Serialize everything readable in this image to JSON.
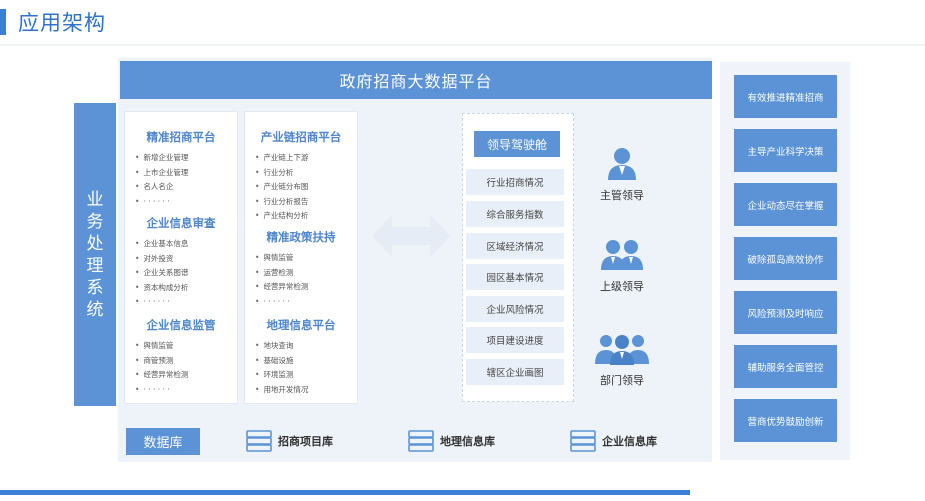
{
  "header": {
    "title": "应用架构"
  },
  "platform": {
    "title": "政府招商大数据平台"
  },
  "side_column": {
    "chars": [
      "业",
      "务",
      "处",
      "理",
      "系",
      "统"
    ]
  },
  "left_panel": {
    "sections": [
      {
        "title": "精准招商平台",
        "items": [
          "新增企业管理",
          "上市企业管理",
          "名人名企",
          "· · · · · ·"
        ]
      },
      {
        "title": "企业信息审查",
        "items": [
          "企业基本信息",
          "对外投资",
          "企业关系图谱",
          "资本构成分析",
          "· · · · · ·"
        ]
      },
      {
        "title": "企业信息监管",
        "items": [
          "舆情监管",
          "商管预测",
          "经营异常检测",
          "· · · · · ·"
        ]
      }
    ]
  },
  "middle_panel": {
    "sections": [
      {
        "title": "产业链招商平台",
        "items": [
          "产业链上下游",
          "行业分析",
          "产业链分布图",
          "行业分析报告",
          "产业结构分析"
        ]
      },
      {
        "title": "精准政策扶持",
        "items": [
          "舆情监管",
          "运营检测",
          "经营异常检测",
          "· · · · · ·"
        ]
      },
      {
        "title": "地理信息平台",
        "items": [
          "地块查询",
          "基础设施",
          "环境监测",
          "用地开发情况"
        ]
      }
    ]
  },
  "cockpit": {
    "title": "领导驾驶舱",
    "items": [
      "行业招商情况",
      "综合服务指数",
      "区域经济情况",
      "园区基本情况",
      "企业风险情况",
      "项目建设进度",
      "辖区企业画图"
    ]
  },
  "roles": [
    {
      "label": "主管领导",
      "icon": "single-user-icon"
    },
    {
      "label": "上级领导",
      "icon": "two-users-icon"
    },
    {
      "label": "部门领导",
      "icon": "group-users-icon"
    }
  ],
  "database": {
    "label": "数据库",
    "items": [
      {
        "label": "招商项目库",
        "icon": "database-icon"
      },
      {
        "label": "地理信息库",
        "icon": "database-icon"
      },
      {
        "label": "企业信息库",
        "icon": "database-icon"
      }
    ]
  },
  "goals": [
    "有效推进精准招商",
    "主导产业科学决策",
    "企业动态尽在掌握",
    "破除孤岛高效协作",
    "风险预测及时响应",
    "辅助服务全面管控",
    "营商优势鼓励创新"
  ],
  "colors": {
    "accent": "#5b93d6",
    "title": "#2f73c8",
    "panel_bg": "#eef3f9"
  }
}
